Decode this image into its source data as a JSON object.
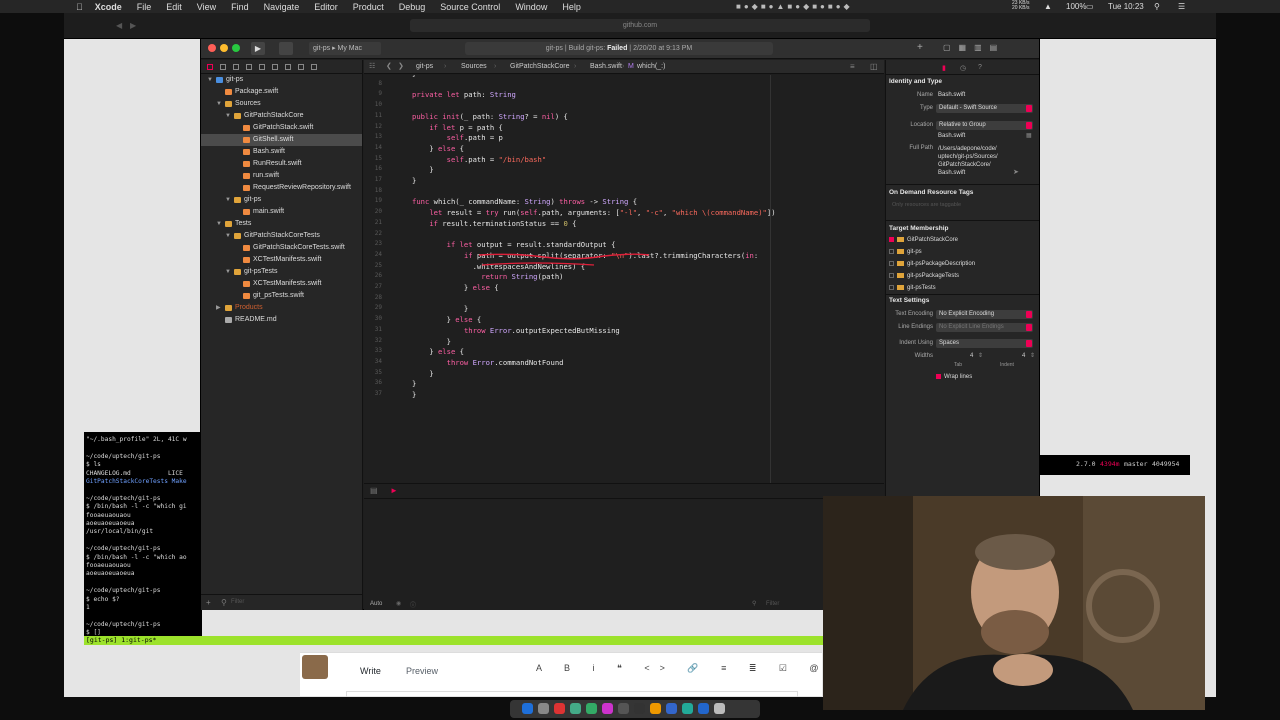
{
  "menubar": {
    "app": "Xcode",
    "items": [
      "File",
      "Edit",
      "View",
      "Find",
      "Navigate",
      "Editor",
      "Product",
      "Debug",
      "Source Control",
      "Window",
      "Help"
    ],
    "net_up": "23 KB/s",
    "net_down": "20 KB/s",
    "battery": "100%",
    "clock": "Tue 10:23"
  },
  "browser": {
    "url": "github.com"
  },
  "xcode": {
    "scheme": "git-ps",
    "destination": "My Mac",
    "status_prefix": "git-ps | Build git-ps:",
    "status_result": "Failed",
    "status_time": "2/20/20 at 9:13 PM",
    "breadcrumbs": [
      "git-ps",
      "Sources",
      "GitPatchStackCore",
      "Bash.swift",
      "which(_:)"
    ],
    "navigator": [
      {
        "label": "git-ps",
        "depth": 0,
        "type": "project",
        "open": true
      },
      {
        "label": "Package.swift",
        "depth": 1,
        "type": "file"
      },
      {
        "label": "Sources",
        "depth": 1,
        "type": "folder",
        "open": true
      },
      {
        "label": "GitPatchStackCore",
        "depth": 2,
        "type": "folder",
        "open": true
      },
      {
        "label": "GitPatchStack.swift",
        "depth": 3,
        "type": "file"
      },
      {
        "label": "GitShell.swift",
        "depth": 3,
        "type": "file",
        "selected": true
      },
      {
        "label": "Bash.swift",
        "depth": 3,
        "type": "file"
      },
      {
        "label": "RunResult.swift",
        "depth": 3,
        "type": "file"
      },
      {
        "label": "run.swift",
        "depth": 3,
        "type": "file"
      },
      {
        "label": "RequestReviewRepository.swift",
        "depth": 3,
        "type": "file"
      },
      {
        "label": "git-ps",
        "depth": 2,
        "type": "folder",
        "open": true
      },
      {
        "label": "main.swift",
        "depth": 3,
        "type": "file"
      },
      {
        "label": "Tests",
        "depth": 1,
        "type": "folder",
        "open": true
      },
      {
        "label": "GitPatchStackCoreTests",
        "depth": 2,
        "type": "folder",
        "open": true
      },
      {
        "label": "GitPatchStackCoreTests.swift",
        "depth": 3,
        "type": "file"
      },
      {
        "label": "XCTestManifests.swift",
        "depth": 3,
        "type": "file"
      },
      {
        "label": "git-psTests",
        "depth": 2,
        "type": "folder",
        "open": true
      },
      {
        "label": "XCTestManifests.swift",
        "depth": 3,
        "type": "file"
      },
      {
        "label": "git_psTests.swift",
        "depth": 3,
        "type": "file"
      },
      {
        "label": "Products",
        "depth": 1,
        "type": "products",
        "open": false
      },
      {
        "label": "README.md",
        "depth": 1,
        "type": "doc"
      }
    ],
    "nav_filter_placeholder": "Filter",
    "debug_auto": "Auto",
    "debug_filter_placeholder": "Filter",
    "line_numbers": [
      "7",
      "8",
      "9",
      "10",
      "11",
      "12",
      "13",
      "14",
      "15",
      "16",
      "17",
      "18",
      "19",
      "20",
      "21",
      "22",
      "23",
      "24",
      "25",
      "26",
      "27",
      "28",
      "29",
      "30",
      "31",
      "32",
      "33",
      "34",
      "35",
      "36",
      "37"
    ],
    "code_lines": [
      "}",
      "",
      "private let path: String",
      "",
      "public init(_ path: String? = nil) {",
      "    if let p = path {",
      "        self.path = p",
      "    } else {",
      "        self.path = \"/bin/bash\"",
      "    }",
      "}",
      "",
      "func which(_ commandName: String) throws -> String {",
      "    let result = try run(self.path, arguments: [\"-l\", \"-c\", \"which \\(commandName)\"])",
      "    if result.terminationStatus == 0 {",
      "",
      "        if let output = result.standardOutput {",
      "            if path = output.split(separator: \"\\n\").last?.trimmingCharacters(in:",
      "              .whitespacesAndNewlines) {",
      "                return String(path)",
      "            } else {",
      "",
      "            }",
      "        } else {",
      "            throw Error.outputExpectedButMissing",
      "        }",
      "    } else {",
      "        throw Error.commandNotFound",
      "    }",
      "}",
      "}",
      ""
    ],
    "inspector": {
      "identity_header": "Identity and Type",
      "name_label": "Name",
      "name_value": "Bash.swift",
      "type_label": "Type",
      "type_value": "Default - Swift Source",
      "location_label": "Location",
      "location_value": "Relative to Group",
      "location_file": "Bash.swift",
      "fullpath_label": "Full Path",
      "fullpath_value": [
        "/Users/adepone/code/",
        "uptech/git-ps/Sources/",
        "GitPatchStackCore/",
        "Bash.swift"
      ],
      "ondemand_header": "On Demand Resource Tags",
      "ondemand_placeholder": "Only resources are taggable",
      "target_header": "Target Membership",
      "targets": [
        {
          "label": "GitPatchStackCore",
          "checked": true
        },
        {
          "label": "git-ps",
          "checked": false
        },
        {
          "label": "git-psPackageDescription",
          "checked": false
        },
        {
          "label": "git-psPackageTests",
          "checked": false
        },
        {
          "label": "git-psTests",
          "checked": false
        }
      ],
      "text_header": "Text Settings",
      "encoding_label": "Text Encoding",
      "encoding_value": "No Explicit Encoding",
      "endings_label": "Line Endings",
      "endings_value": "No Explicit Line Endings",
      "indent_label": "Indent Using",
      "indent_value": "Spaces",
      "widths_label": "Widths",
      "tab_value": "4",
      "indent_width_value": "4",
      "tab_caption": "Tab",
      "indent_caption": "Indent",
      "wrap_label": "Wrap lines"
    }
  },
  "terminal": {
    "lines": [
      "\"~/.bash_profile\" 2L, 41C w",
      "",
      "~/code/uptech/git-ps",
      "$ ls",
      "CHANGELOG.md          LICE",
      "GitPatchStackCoreTests Make",
      "",
      "~/code/uptech/git-ps",
      "$ /bin/bash -l -c \"which gi",
      "fooaeuaouaou",
      "aoeuaoeuaoeua",
      "/usr/local/bin/git",
      "",
      "~/code/uptech/git-ps",
      "$ /bin/bash -l -c \"which ao",
      "fooaeuaouaou",
      "aoeuaoeuaoeua",
      "",
      "~/code/uptech/git-ps",
      "$ echo $?",
      "1",
      "",
      "~/code/uptech/git-ps",
      "$ []"
    ],
    "tmux_status": "[git-ps] 1:git-ps*",
    "right_status": {
      "version": "2.7.0",
      "mem": "4394m",
      "branch": "master",
      "hash": "4049954"
    }
  },
  "github": {
    "write_tab": "Write",
    "preview_tab": "Preview"
  },
  "colors": {
    "accent": "#e0005a",
    "tmux_green": "#9ce22b",
    "failed": "#ffffff"
  }
}
